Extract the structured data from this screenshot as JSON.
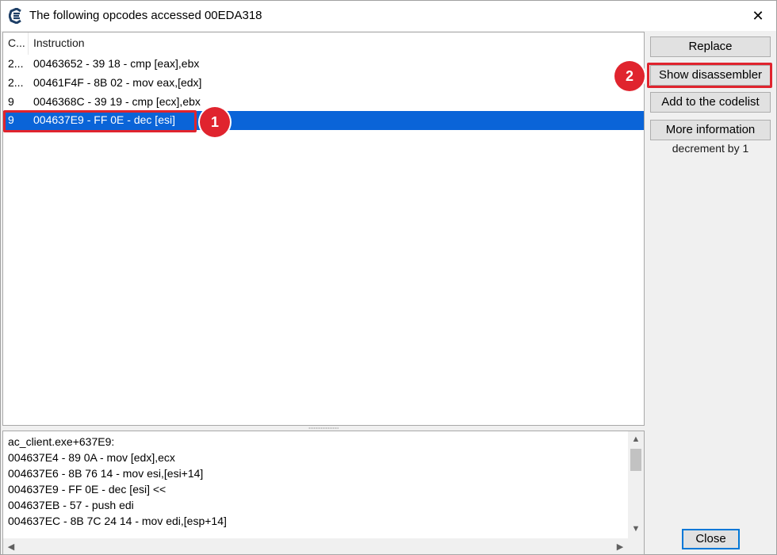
{
  "window": {
    "title": "The following opcodes accessed 00EDA318",
    "close_glyph": "✕"
  },
  "list": {
    "columns": [
      "C...",
      "Instruction"
    ],
    "rows": [
      {
        "count": "2...",
        "instruction": "00463652 - 39 18  - cmp [eax],ebx",
        "selected": false
      },
      {
        "count": "2...",
        "instruction": "00461F4F - 8B 02  - mov eax,[edx]",
        "selected": false
      },
      {
        "count": "9",
        "instruction": "0046368C - 39 19  - cmp [ecx],ebx",
        "selected": false
      },
      {
        "count": "9",
        "instruction": "004637E9 - FF 0E  - dec [esi]",
        "selected": true
      }
    ]
  },
  "disasm": {
    "lines": [
      "ac_client.exe+637E9:",
      "004637E4 - 89 0A  - mov [edx],ecx",
      "004637E6 - 8B 76 14  - mov esi,[esi+14]",
      "004637E9 - FF 0E  - dec [esi] <<",
      "004637EB - 57 - push edi",
      "004637EC - 8B 7C 24 14  - mov edi,[esp+14]"
    ]
  },
  "buttons": {
    "replace": "Replace",
    "show_disassembler": "Show disassembler",
    "add_to_codelist": "Add to the codelist",
    "more_information": "More information",
    "close": "Close"
  },
  "description": "decrement by 1",
  "annotations": {
    "badge1": "1",
    "badge2": "2",
    "color": "#e0242e"
  },
  "colors": {
    "selection": "#0a64d8"
  }
}
